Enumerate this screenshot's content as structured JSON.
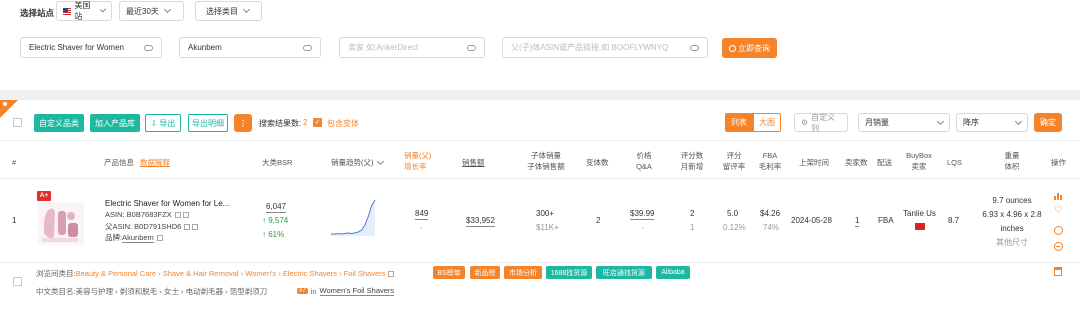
{
  "filters": {
    "site_label": "选择站点",
    "site_value": "美国站",
    "period_value": "最近30天",
    "category_value": "选择类目"
  },
  "search": {
    "keyword_value": "Electric Shaver for Women",
    "brand_value": "Akunbem",
    "seller_placeholder": "卖家 如:AnkerDirect",
    "asin_placeholder": "父(子)体ASIN或产品链接,如 BOOFLYWNYQ",
    "query_button": "立即查询"
  },
  "toolbar": {
    "custom_category": "自定义品类",
    "add_to_library": "加入产品库",
    "export": "导出",
    "export_detail": "导出明细",
    "more": "⋮",
    "result_count_label": "搜索结果数:",
    "result_count": "2",
    "include_variants": "包含变体",
    "view_list": "列表",
    "view_grid": "大图",
    "custom_columns": "自定义列",
    "sort_field": "月销量",
    "sort_order": "降序",
    "confirm": "确定"
  },
  "columns": {
    "index": "#",
    "product_info": "产品信息",
    "data_explain": "数据解释",
    "bsr": "大类BSR",
    "sales_trend": "销量趋势(父)",
    "sales_line1": "销量(父)",
    "sales_line2": "增长率",
    "revenue": "销售额",
    "child_sales_line1": "子体销量",
    "child_sales_line2": "子体销售额",
    "variants": "变体数",
    "price_line1": "价格",
    "price_line2": "Q&A",
    "ratings_line1": "评分数",
    "ratings_line2": "月新增",
    "rating_line1": "评分",
    "rating_line2": "留评率",
    "fba_line1": "FBA",
    "fba_line2": "毛利率",
    "launch": "上架时间",
    "sellers": "卖家数",
    "fulfillment": "配送",
    "buybox_line1": "BuyBox",
    "buybox_line2": "卖家",
    "lqs": "LQS",
    "weight_line1": "重量",
    "weight_line2": "体积",
    "actions": "操作"
  },
  "row": {
    "index": "1",
    "badge": "A+",
    "title": "Electric Shaver for Women for Le...",
    "asin": "ASIN: B0B7683FZX",
    "parent_asin": "父ASIN: B0D791SHD6",
    "brand_label": "品牌:",
    "brand": "Akunbem",
    "bsr": "6,047",
    "bsr_change": "↑ 9,574",
    "bsr_pct": "↑ 61%",
    "sales": "849",
    "sales_growth": "-",
    "revenue": "$33,952",
    "child_sales": "300+",
    "child_revenue": "$11K+",
    "variants": "2",
    "price": "$39.99",
    "qa": "-",
    "ratings": "2",
    "ratings_new": "1",
    "rating": "5.0",
    "review_rate": "0.12%",
    "fba_fee": "$4.26",
    "margin": "74%",
    "launch": "2024-05-28",
    "sellers": "1",
    "fulfillment": "FBA",
    "buybox_seller": "Tanlie Us",
    "lqs": "8.7",
    "weight": "9.7 ounces",
    "dimensions_line1": "6.93 x 4.96 x 2.8",
    "dimensions_line2": "inches",
    "size_type": "其他尺寸"
  },
  "category": {
    "browse_label": "浏览间类目:",
    "path": [
      "Beauty & Personal Care",
      "Shave & Hair Removal",
      "Women's",
      "Electric Shavers",
      "Foil Shavers"
    ],
    "tags": [
      "BS榜单",
      "新品榜",
      "市场分析",
      "1688找货源",
      "旺店通找货源",
      "Alibaba"
    ],
    "cn_label": "中文类目名:",
    "cn_path": "美容与护理 › 剃须和脱毛 › 女士 › 电动剃毛器 › 箔型剃须刀",
    "rank_badge": "#7",
    "rank_in": "in",
    "rank_category": "Women's Foil Shavers"
  },
  "colors": {
    "accent_orange": "#f5832a",
    "teal": "#1db8a2",
    "green": "#2a9d49"
  },
  "sparkline": [
    4,
    4,
    5,
    4,
    5,
    6,
    5,
    6,
    8,
    12,
    22,
    40,
    62,
    74
  ]
}
